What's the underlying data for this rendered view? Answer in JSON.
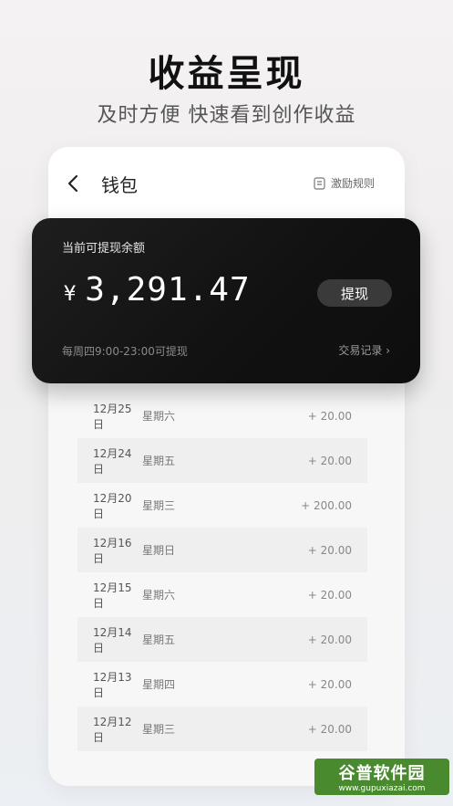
{
  "hero": {
    "title": "收益呈现",
    "subtitle": "及时方便 快速看到创作收益"
  },
  "header": {
    "title": "钱包",
    "rules_label": "激励规则"
  },
  "card": {
    "label": "当前可提现余额",
    "currency": "¥",
    "balance": "3,291.47",
    "withdraw_label": "提现",
    "note": "每周四9:00-23:00可提现",
    "records_label": "交易记录 ›"
  },
  "transactions": [
    {
      "date": "12月25日",
      "weekday": "星期六",
      "amount": "+  20.00"
    },
    {
      "date": "12月24日",
      "weekday": "星期五",
      "amount": "+  20.00"
    },
    {
      "date": "12月20日",
      "weekday": "星期三",
      "amount": "+  200.00"
    },
    {
      "date": "12月16日",
      "weekday": "星期日",
      "amount": "+  20.00"
    },
    {
      "date": "12月15日",
      "weekday": "星期六",
      "amount": "+  20.00"
    },
    {
      "date": "12月14日",
      "weekday": "星期五",
      "amount": "+  20.00"
    },
    {
      "date": "12月13日",
      "weekday": "星期四",
      "amount": "+  20.00"
    },
    {
      "date": "12月12日",
      "weekday": "星期三",
      "amount": "+  20.00"
    }
  ],
  "watermark": {
    "name": "谷普软件园",
    "url": "www.gupuxiazai.com"
  },
  "icons": {
    "back": "back-arrow-icon",
    "rules": "document-icon"
  },
  "colors": {
    "card_bg": "#111111",
    "withdraw_btn": "#3a3a3a"
  }
}
